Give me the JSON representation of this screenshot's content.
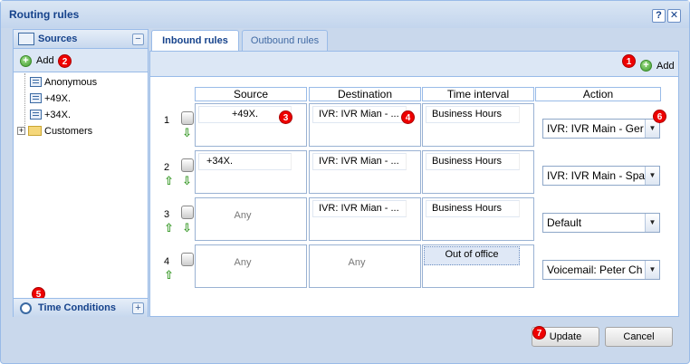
{
  "window": {
    "title": "Routing rules",
    "help": "?",
    "close": "✕"
  },
  "sources": {
    "title": "Sources",
    "collapse": "−",
    "add_label": "Add",
    "badge": "2",
    "items": [
      "Anonymous",
      "+49X.",
      "+34X.",
      "Customers"
    ]
  },
  "time_conditions": {
    "title": "Time Conditions",
    "expand": "+",
    "badge": "5"
  },
  "tabs": [
    "Inbound rules",
    "Outbound rules"
  ],
  "toolbar": {
    "add_label": "Add",
    "badge": "1"
  },
  "columns": [
    "Source",
    "Destination",
    "Time interval",
    "Action"
  ],
  "rows": [
    {
      "num": "1",
      "source": "+49X.",
      "destination": "IVR: IVR Mian - ...",
      "time": "Business Hours",
      "action": "IVR: IVR Main - Ger",
      "source_badge": "3",
      "dest_badge": "4",
      "action_badge": "6"
    },
    {
      "num": "2",
      "source": "+34X.",
      "destination": "IVR: IVR Mian - ...",
      "time": "Business Hours",
      "action": "IVR: IVR Main - Spa"
    },
    {
      "num": "3",
      "source": "Any",
      "destination": "IVR: IVR Mian - ...",
      "time": "Business Hours",
      "action": "Default"
    },
    {
      "num": "4",
      "source": "Any",
      "destination": "Any",
      "time": "Out of office",
      "action": "Voicemail: Peter Ch"
    }
  ],
  "buttons": {
    "update": "Update",
    "cancel": "Cancel",
    "update_badge": "7"
  }
}
